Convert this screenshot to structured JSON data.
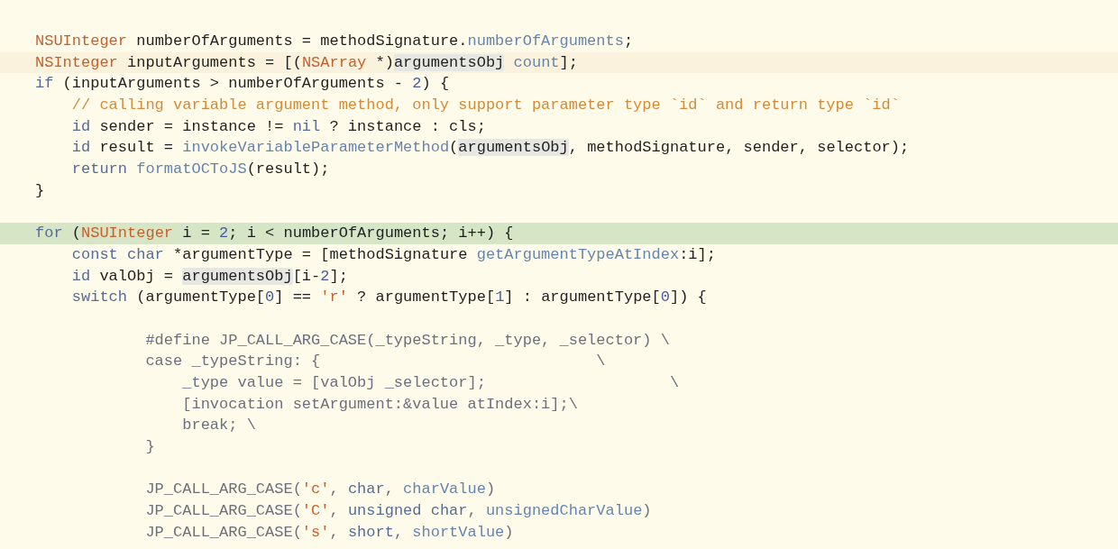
{
  "editor": {
    "lines": [
      {
        "kind": "normal",
        "segments": [
          {
            "kind": "type",
            "text": "NSUInteger"
          },
          {
            "kind": "plain",
            "text": " numberOfArguments = methodSignature."
          },
          {
            "kind": "method",
            "text": "numberOfArguments"
          },
          {
            "kind": "plain",
            "text": ";"
          }
        ]
      },
      {
        "kind": "cursor",
        "segments": [
          {
            "kind": "type",
            "text": "NSInteger"
          },
          {
            "kind": "plain",
            "text": " inputArguments = [("
          },
          {
            "kind": "type",
            "text": "NSArray"
          },
          {
            "kind": "plain",
            "text": " *)"
          },
          {
            "kind": "occurrence",
            "text": "argumentsObj"
          },
          {
            "kind": "method",
            "text": " count"
          },
          {
            "kind": "plain",
            "text": "];"
          }
        ]
      },
      {
        "kind": "normal",
        "segments": [
          {
            "kind": "keyword",
            "text": "if"
          },
          {
            "kind": "plain",
            "text": " (inputArguments > numberOfArguments - "
          },
          {
            "kind": "number",
            "text": "2"
          },
          {
            "kind": "plain",
            "text": ") {"
          }
        ]
      },
      {
        "kind": "normal",
        "segments": [
          {
            "kind": "comment",
            "text": "    // calling variable argument method, only support parameter type `id` and return type `id`"
          }
        ]
      },
      {
        "kind": "normal",
        "segments": [
          {
            "kind": "keyword",
            "text": "    id"
          },
          {
            "kind": "plain",
            "text": " sender = instance != "
          },
          {
            "kind": "keyword",
            "text": "nil"
          },
          {
            "kind": "plain",
            "text": " ? instance : cls;"
          }
        ]
      },
      {
        "kind": "normal",
        "segments": [
          {
            "kind": "keyword",
            "text": "    id"
          },
          {
            "kind": "plain",
            "text": " result = "
          },
          {
            "kind": "method",
            "text": "invokeVariableParameterMethod"
          },
          {
            "kind": "plain",
            "text": "("
          },
          {
            "kind": "occurrence",
            "text": "argumentsObj"
          },
          {
            "kind": "plain",
            "text": ", methodSignature, sender, selector);"
          }
        ]
      },
      {
        "kind": "normal",
        "segments": [
          {
            "kind": "keyword",
            "text": "    return"
          },
          {
            "kind": "method",
            "text": " formatOCToJS"
          },
          {
            "kind": "plain",
            "text": "(result);"
          }
        ]
      },
      {
        "kind": "normal",
        "segments": [
          {
            "kind": "plain",
            "text": "}"
          }
        ]
      },
      {
        "kind": "blank"
      },
      {
        "kind": "execution",
        "segments": [
          {
            "kind": "keyword",
            "text": "for"
          },
          {
            "kind": "plain",
            "text": " ("
          },
          {
            "kind": "type",
            "text": "NSUInteger"
          },
          {
            "kind": "plain",
            "text": " i = "
          },
          {
            "kind": "number",
            "text": "2"
          },
          {
            "kind": "plain",
            "text": "; i < numberOfArguments; i++) {"
          }
        ]
      },
      {
        "kind": "normal",
        "segments": [
          {
            "kind": "keyword",
            "text": "    const char"
          },
          {
            "kind": "plain",
            "text": " *argumentType = [methodSignature "
          },
          {
            "kind": "method",
            "text": "getArgumentTypeAtIndex"
          },
          {
            "kind": "plain",
            "text": ":i];"
          }
        ]
      },
      {
        "kind": "normal",
        "segments": [
          {
            "kind": "keyword",
            "text": "    id"
          },
          {
            "kind": "plain",
            "text": " valObj = "
          },
          {
            "kind": "occurrence",
            "text": "argumentsObj"
          },
          {
            "kind": "plain",
            "text": "[i-"
          },
          {
            "kind": "number",
            "text": "2"
          },
          {
            "kind": "plain",
            "text": "];"
          }
        ]
      },
      {
        "kind": "normal",
        "segments": [
          {
            "kind": "keyword",
            "text": "    switch"
          },
          {
            "kind": "plain",
            "text": " (argumentType["
          },
          {
            "kind": "number",
            "text": "0"
          },
          {
            "kind": "plain",
            "text": "] == "
          },
          {
            "kind": "string",
            "text": "'r'"
          },
          {
            "kind": "plain",
            "text": " ? argumentType["
          },
          {
            "kind": "number",
            "text": "1"
          },
          {
            "kind": "plain",
            "text": "] : argumentType["
          },
          {
            "kind": "number",
            "text": "0"
          },
          {
            "kind": "plain",
            "text": "]) {"
          }
        ]
      },
      {
        "kind": "blank"
      },
      {
        "kind": "normal",
        "segments": [
          {
            "kind": "macro",
            "text": "            #define JP_CALL_ARG_CASE(_typeString, _type, _selector) \\"
          }
        ]
      },
      {
        "kind": "normal",
        "segments": [
          {
            "kind": "macro",
            "text": "            case _typeString: {                              \\"
          }
        ]
      },
      {
        "kind": "normal",
        "segments": [
          {
            "kind": "macro",
            "text": "                _type value = [valObj _selector];                    \\"
          }
        ]
      },
      {
        "kind": "normal",
        "segments": [
          {
            "kind": "macro",
            "text": "                [invocation setArgument:&value atIndex:i];\\"
          }
        ]
      },
      {
        "kind": "normal",
        "segments": [
          {
            "kind": "macro",
            "text": "                break; \\"
          }
        ]
      },
      {
        "kind": "normal",
        "segments": [
          {
            "kind": "macro",
            "text": "            }"
          }
        ]
      },
      {
        "kind": "blank"
      },
      {
        "kind": "normal",
        "segments": [
          {
            "kind": "macro",
            "text": "            JP_CALL_ARG_CASE("
          },
          {
            "kind": "string",
            "text": "'c'"
          },
          {
            "kind": "macro",
            "text": ", "
          },
          {
            "kind": "keyword",
            "text": "char"
          },
          {
            "kind": "macro",
            "text": ", "
          },
          {
            "kind": "method",
            "text": "charValue"
          },
          {
            "kind": "macro",
            "text": ")"
          }
        ]
      },
      {
        "kind": "normal",
        "segments": [
          {
            "kind": "macro",
            "text": "            JP_CALL_ARG_CASE("
          },
          {
            "kind": "string",
            "text": "'C'"
          },
          {
            "kind": "macro",
            "text": ", "
          },
          {
            "kind": "keyword",
            "text": "unsigned char"
          },
          {
            "kind": "macro",
            "text": ", "
          },
          {
            "kind": "method",
            "text": "unsignedCharValue"
          },
          {
            "kind": "macro",
            "text": ")"
          }
        ]
      },
      {
        "kind": "normal",
        "segments": [
          {
            "kind": "macro",
            "text": "            JP_CALL_ARG_CASE("
          },
          {
            "kind": "string",
            "text": "'s'"
          },
          {
            "kind": "macro",
            "text": ", "
          },
          {
            "kind": "keyword",
            "text": "short"
          },
          {
            "kind": "macro",
            "text": ", "
          },
          {
            "kind": "method",
            "text": "shortValue"
          },
          {
            "kind": "macro",
            "text": ")"
          }
        ]
      }
    ]
  }
}
